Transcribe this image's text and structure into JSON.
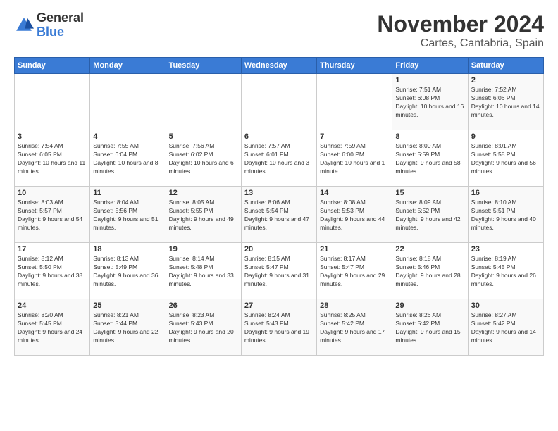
{
  "logo": {
    "general": "General",
    "blue": "Blue"
  },
  "header": {
    "title": "November 2024",
    "location": "Cartes, Cantabria, Spain"
  },
  "weekdays": [
    "Sunday",
    "Monday",
    "Tuesday",
    "Wednesday",
    "Thursday",
    "Friday",
    "Saturday"
  ],
  "weeks": [
    [
      {
        "day": "",
        "info": ""
      },
      {
        "day": "",
        "info": ""
      },
      {
        "day": "",
        "info": ""
      },
      {
        "day": "",
        "info": ""
      },
      {
        "day": "",
        "info": ""
      },
      {
        "day": "1",
        "info": "Sunrise: 7:51 AM\nSunset: 6:08 PM\nDaylight: 10 hours and 16 minutes."
      },
      {
        "day": "2",
        "info": "Sunrise: 7:52 AM\nSunset: 6:06 PM\nDaylight: 10 hours and 14 minutes."
      }
    ],
    [
      {
        "day": "3",
        "info": "Sunrise: 7:54 AM\nSunset: 6:05 PM\nDaylight: 10 hours and 11 minutes."
      },
      {
        "day": "4",
        "info": "Sunrise: 7:55 AM\nSunset: 6:04 PM\nDaylight: 10 hours and 8 minutes."
      },
      {
        "day": "5",
        "info": "Sunrise: 7:56 AM\nSunset: 6:02 PM\nDaylight: 10 hours and 6 minutes."
      },
      {
        "day": "6",
        "info": "Sunrise: 7:57 AM\nSunset: 6:01 PM\nDaylight: 10 hours and 3 minutes."
      },
      {
        "day": "7",
        "info": "Sunrise: 7:59 AM\nSunset: 6:00 PM\nDaylight: 10 hours and 1 minute."
      },
      {
        "day": "8",
        "info": "Sunrise: 8:00 AM\nSunset: 5:59 PM\nDaylight: 9 hours and 58 minutes."
      },
      {
        "day": "9",
        "info": "Sunrise: 8:01 AM\nSunset: 5:58 PM\nDaylight: 9 hours and 56 minutes."
      }
    ],
    [
      {
        "day": "10",
        "info": "Sunrise: 8:03 AM\nSunset: 5:57 PM\nDaylight: 9 hours and 54 minutes."
      },
      {
        "day": "11",
        "info": "Sunrise: 8:04 AM\nSunset: 5:56 PM\nDaylight: 9 hours and 51 minutes."
      },
      {
        "day": "12",
        "info": "Sunrise: 8:05 AM\nSunset: 5:55 PM\nDaylight: 9 hours and 49 minutes."
      },
      {
        "day": "13",
        "info": "Sunrise: 8:06 AM\nSunset: 5:54 PM\nDaylight: 9 hours and 47 minutes."
      },
      {
        "day": "14",
        "info": "Sunrise: 8:08 AM\nSunset: 5:53 PM\nDaylight: 9 hours and 44 minutes."
      },
      {
        "day": "15",
        "info": "Sunrise: 8:09 AM\nSunset: 5:52 PM\nDaylight: 9 hours and 42 minutes."
      },
      {
        "day": "16",
        "info": "Sunrise: 8:10 AM\nSunset: 5:51 PM\nDaylight: 9 hours and 40 minutes."
      }
    ],
    [
      {
        "day": "17",
        "info": "Sunrise: 8:12 AM\nSunset: 5:50 PM\nDaylight: 9 hours and 38 minutes."
      },
      {
        "day": "18",
        "info": "Sunrise: 8:13 AM\nSunset: 5:49 PM\nDaylight: 9 hours and 36 minutes."
      },
      {
        "day": "19",
        "info": "Sunrise: 8:14 AM\nSunset: 5:48 PM\nDaylight: 9 hours and 33 minutes."
      },
      {
        "day": "20",
        "info": "Sunrise: 8:15 AM\nSunset: 5:47 PM\nDaylight: 9 hours and 31 minutes."
      },
      {
        "day": "21",
        "info": "Sunrise: 8:17 AM\nSunset: 5:47 PM\nDaylight: 9 hours and 29 minutes."
      },
      {
        "day": "22",
        "info": "Sunrise: 8:18 AM\nSunset: 5:46 PM\nDaylight: 9 hours and 28 minutes."
      },
      {
        "day": "23",
        "info": "Sunrise: 8:19 AM\nSunset: 5:45 PM\nDaylight: 9 hours and 26 minutes."
      }
    ],
    [
      {
        "day": "24",
        "info": "Sunrise: 8:20 AM\nSunset: 5:45 PM\nDaylight: 9 hours and 24 minutes."
      },
      {
        "day": "25",
        "info": "Sunrise: 8:21 AM\nSunset: 5:44 PM\nDaylight: 9 hours and 22 minutes."
      },
      {
        "day": "26",
        "info": "Sunrise: 8:23 AM\nSunset: 5:43 PM\nDaylight: 9 hours and 20 minutes."
      },
      {
        "day": "27",
        "info": "Sunrise: 8:24 AM\nSunset: 5:43 PM\nDaylight: 9 hours and 19 minutes."
      },
      {
        "day": "28",
        "info": "Sunrise: 8:25 AM\nSunset: 5:42 PM\nDaylight: 9 hours and 17 minutes."
      },
      {
        "day": "29",
        "info": "Sunrise: 8:26 AM\nSunset: 5:42 PM\nDaylight: 9 hours and 15 minutes."
      },
      {
        "day": "30",
        "info": "Sunrise: 8:27 AM\nSunset: 5:42 PM\nDaylight: 9 hours and 14 minutes."
      }
    ]
  ]
}
